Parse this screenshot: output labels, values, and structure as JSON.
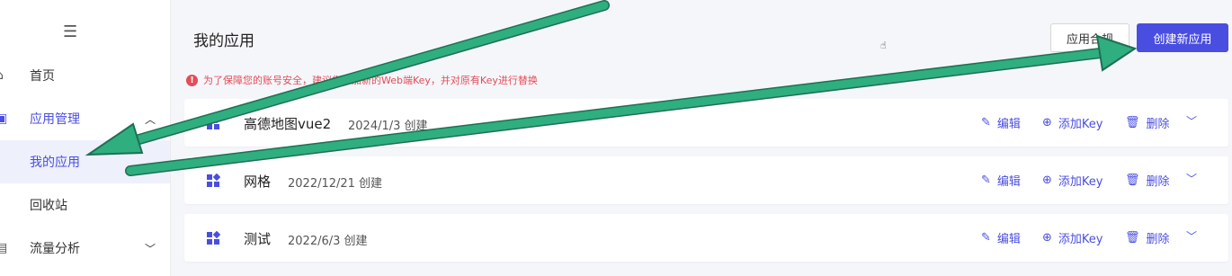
{
  "sidebar": {
    "menu_icon": "hamburger-icon",
    "items": [
      {
        "label": "首页",
        "icon": "home-icon"
      },
      {
        "label": "应用管理",
        "icon": "app-grid-icon",
        "chevron": "chevron-up-icon"
      },
      {
        "label": "我的应用"
      },
      {
        "label": "回收站"
      },
      {
        "label": "流量分析",
        "icon": "chart-icon",
        "chevron": "chevron-down-icon"
      }
    ]
  },
  "header": {
    "title": "我的应用",
    "compliance_label": "应用合规",
    "create_label": "创建新应用"
  },
  "notice": {
    "text": "为了保障您的账号安全，建议您添加新的Web端Key，并对原有Key进行替换"
  },
  "apps": [
    {
      "name": "高德地图vue2",
      "date": "2024/1/3 创建"
    },
    {
      "name": "网格",
      "date": "2022/12/21 创建"
    },
    {
      "name": "测试",
      "date": "2022/6/3 创建"
    }
  ],
  "actions": {
    "edit": "编辑",
    "add_key": "添加Key",
    "delete": "删除"
  },
  "colors": {
    "accent": "#4a4ee0",
    "warning": "#e34d59",
    "annotation_arrow": "#2a9d74"
  }
}
